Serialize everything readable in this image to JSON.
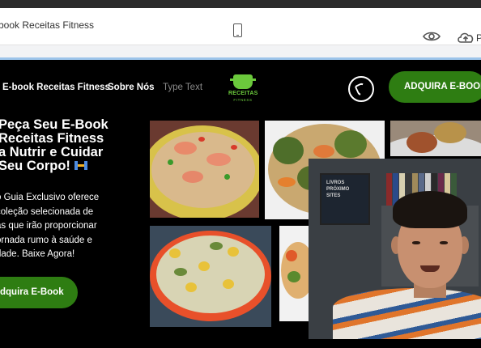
{
  "editor": {
    "page_title": "book Receitas Fitness",
    "trailing_text": "P"
  },
  "site": {
    "nav": {
      "items": [
        "E-book Receitas Fitness",
        "Sobre Nós",
        "Type Text"
      ],
      "cta": "ADQUIRA E-BOOK!"
    },
    "logo": {
      "text": "RECEITAS",
      "subtext": "FITNESS"
    },
    "hero": {
      "title_lines": [
        "Peça Seu E-Book",
        "Receitas Fitness",
        "a Nutrir e Cuidar",
        "Seu Corpo!"
      ],
      "description_lines": [
        "o Guia Exclusivo oferece",
        "coleção selecionada de",
        "as que irão proporcionar",
        "ornada rumo à saúde e",
        "dade. Baixe Agora!"
      ],
      "cta": "dquira E-Book"
    },
    "shelf_text_lines": [
      "LIVROS",
      "PRÓXIMO",
      "SITES"
    ]
  },
  "colors": {
    "brand_green": "#2e7d12",
    "logo_green": "#6bc93c",
    "accent_blue": "#9cc4ea"
  },
  "icons": [
    "mobile-device-icon",
    "eye-icon",
    "cloud-upload-icon",
    "whatsapp-icon",
    "dumbbell-icon"
  ]
}
